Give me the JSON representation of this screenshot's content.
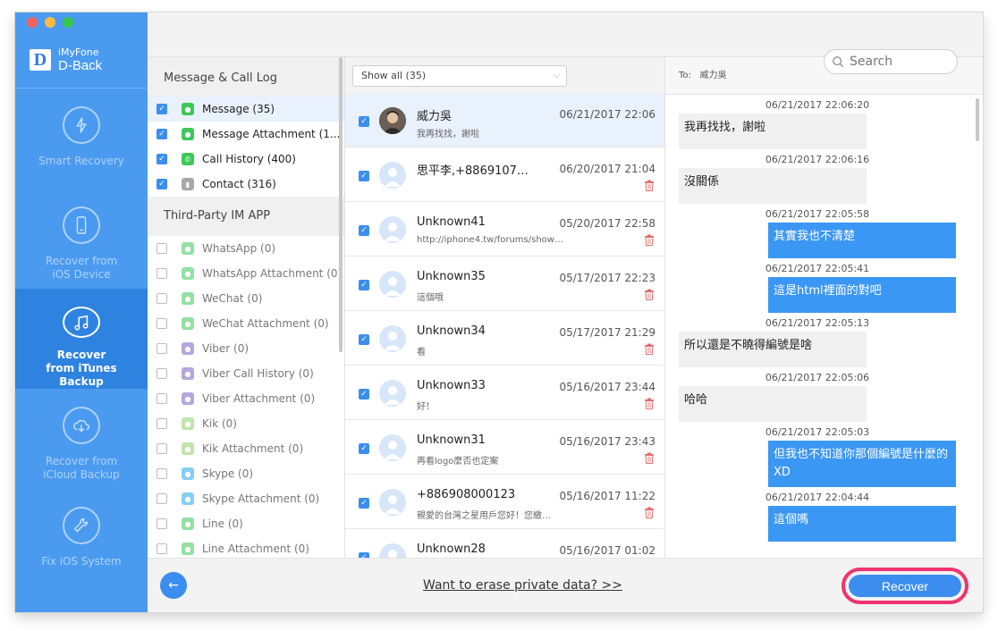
{
  "app": {
    "brand_top": "iMyFone",
    "brand_name": "D-Back",
    "logo_letter": "D"
  },
  "sidebar": {
    "items": [
      {
        "label": "Smart Recovery",
        "icon": "lightning-recovery-icon",
        "active": false
      },
      {
        "label": "Recover from iOS Device",
        "icon": "phone-icon",
        "active": false
      },
      {
        "label": "Recover from iTunes Backup",
        "icon": "music-note-icon",
        "active": true
      },
      {
        "label": "Recover from iCloud Backup",
        "icon": "cloud-download-icon",
        "active": false
      },
      {
        "label": "Fix iOS System",
        "icon": "wrench-icon",
        "active": false
      }
    ]
  },
  "categories": {
    "section1_title": "Message & Call Log",
    "section1_items": [
      {
        "label": "Message (35)",
        "checked": true,
        "icon_color": "#3cc95a"
      },
      {
        "label": "Message Attachment (1...",
        "checked": true,
        "icon_color": "#3cc95a"
      },
      {
        "label": "Call History (400)",
        "checked": true,
        "icon_color": "#3cc95a"
      },
      {
        "label": "Contact (316)",
        "checked": true,
        "icon_color": "#a8a8a8"
      }
    ],
    "section2_title": "Third-Party IM APP",
    "section2_items": [
      {
        "label": "WhatsApp (0)",
        "icon_color": "#3cc95a"
      },
      {
        "label": "WhatsApp Attachment (0)",
        "icon_color": "#3cc95a"
      },
      {
        "label": "WeChat (0)",
        "icon_color": "#3cc95a"
      },
      {
        "label": "WeChat Attachment (0)",
        "icon_color": "#3cc95a"
      },
      {
        "label": "Viber (0)",
        "icon_color": "#7b5fc4"
      },
      {
        "label": "Viber Call History (0)",
        "icon_color": "#7b5fc4"
      },
      {
        "label": "Viber Attachment (0)",
        "icon_color": "#7b5fc4"
      },
      {
        "label": "Kik (0)",
        "icon_color": "#8fd06a"
      },
      {
        "label": "Kik Attachment (0)",
        "icon_color": "#8fd06a"
      },
      {
        "label": "Skype (0)",
        "icon_color": "#20a9e8"
      },
      {
        "label": "Skype Attachment (0)",
        "icon_color": "#20a9e8"
      },
      {
        "label": "Line (0)",
        "icon_color": "#3cc95a"
      },
      {
        "label": "Line Attachment (0)",
        "icon_color": "#3cc95a"
      }
    ]
  },
  "list": {
    "filter": "Show all (35)",
    "messages": [
      {
        "name": "威力吳",
        "date": "06/21/2017 22:06",
        "preview": "我再找找，謝啦",
        "photo": true,
        "trash": false,
        "selected": true
      },
      {
        "name": "思平李,+8869107…",
        "date": "06/20/2017 21:04",
        "preview": "",
        "photo": false,
        "trash": true,
        "selected": false
      },
      {
        "name": "Unknown41",
        "date": "05/20/2017 22:58",
        "preview": "http://iphone4.tw/forums/show…",
        "photo": false,
        "trash": true,
        "selected": false
      },
      {
        "name": "Unknown35",
        "date": "05/17/2017 22:23",
        "preview": "這個哦",
        "photo": false,
        "trash": true,
        "selected": false
      },
      {
        "name": "Unknown34",
        "date": "05/17/2017 21:29",
        "preview": "看",
        "photo": false,
        "trash": true,
        "selected": false
      },
      {
        "name": "Unknown33",
        "date": "05/16/2017 23:44",
        "preview": "好！",
        "photo": false,
        "trash": true,
        "selected": false
      },
      {
        "name": "Unknown31",
        "date": "05/16/2017 23:43",
        "preview": "再看logo麼否也定案",
        "photo": false,
        "trash": true,
        "selected": false
      },
      {
        "name": "+886908000123",
        "date": "05/16/2017 11:22",
        "preview": "親愛的台灣之星用戶您好！您繳…",
        "photo": false,
        "trash": true,
        "selected": false
      },
      {
        "name": "Unknown28",
        "date": "05/16/2017 01:02",
        "preview": "",
        "photo": false,
        "trash": false,
        "selected": false
      }
    ]
  },
  "search": {
    "placeholder": "Search"
  },
  "conversation": {
    "to_label": "To:",
    "to_name": "威力吳",
    "entries": [
      {
        "time": "06/21/2017 22:06:20",
        "text": "我再找找，謝啦",
        "dir": "in"
      },
      {
        "time": "06/21/2017 22:06:16",
        "text": "沒關係",
        "dir": "in"
      },
      {
        "time": "06/21/2017 22:05:58",
        "text": "其實我也不清楚",
        "dir": "out"
      },
      {
        "time": "06/21/2017 22:05:41",
        "text": "這是html裡面的對吧",
        "dir": "out"
      },
      {
        "time": "06/21/2017 22:05:13",
        "text": "所以還是不曉得編號是啥",
        "dir": "in"
      },
      {
        "time": "06/21/2017 22:05:06",
        "text": "哈哈",
        "dir": "in"
      },
      {
        "time": "06/21/2017 22:05:03",
        "text": "但我也不知道你那個編號是什麼的XD",
        "dir": "out"
      },
      {
        "time": "06/21/2017 22:04:44",
        "text": "這個嗎",
        "dir": "out"
      }
    ]
  },
  "footer": {
    "erase_link": "Want to erase private data? >>",
    "recover_label": "Recover",
    "back_icon": "arrow-left-icon"
  },
  "colors": {
    "accent": "#3b8ef0",
    "sidebar": "#4a9af0",
    "highlight": "#f0336e"
  }
}
